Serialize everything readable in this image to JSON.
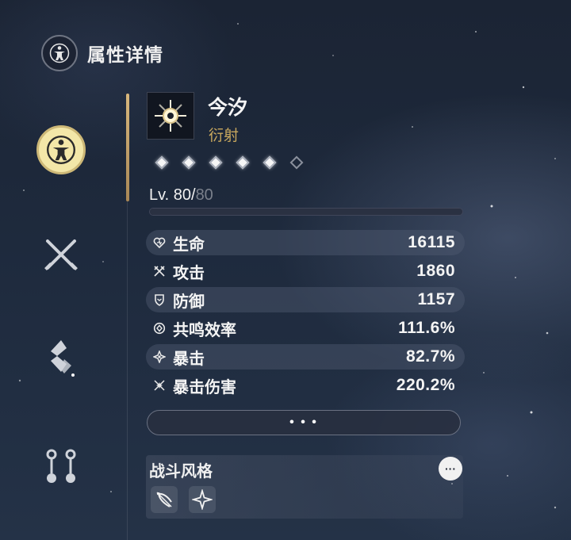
{
  "header": {
    "title": "属性详情",
    "icon": "vitruvian-man-icon"
  },
  "sidebar": {
    "items": [
      {
        "name": "attributes-tab",
        "icon": "vitruvian-man-icon",
        "active": true
      },
      {
        "name": "weapon-tab",
        "icon": "crossed-swords-icon",
        "active": false
      },
      {
        "name": "echo-tab",
        "icon": "echo-icon",
        "active": false
      },
      {
        "name": "forte-tab",
        "icon": "skill-tree-icon",
        "active": false
      }
    ]
  },
  "character": {
    "name": "今汐",
    "attribute": "衍射",
    "attribute_color": "#c9a85e",
    "icon": "spectro-sun-icon",
    "sequence": {
      "unlocked": 5,
      "total": 6
    }
  },
  "level": {
    "prefix": "Lv. 80/",
    "max": "80"
  },
  "stats": [
    {
      "icon": "heart-icon",
      "label": "生命",
      "value": "16115"
    },
    {
      "icon": "attack-icon",
      "label": "攻击",
      "value": "1860"
    },
    {
      "icon": "shield-icon",
      "label": "防御",
      "value": "1157"
    },
    {
      "icon": "energy-regen-icon",
      "label": "共鸣效率",
      "value": "111.6%"
    },
    {
      "icon": "crit-rate-icon",
      "label": "暴击",
      "value": "82.7%"
    },
    {
      "icon": "crit-damage-icon",
      "label": "暴击伤害",
      "value": "220.2%"
    }
  ],
  "more_button": {
    "label": "• • •"
  },
  "combat_style": {
    "title": "战斗风格",
    "more_label": "···",
    "icons": [
      "bow-icon",
      "star-burst-icon"
    ]
  }
}
